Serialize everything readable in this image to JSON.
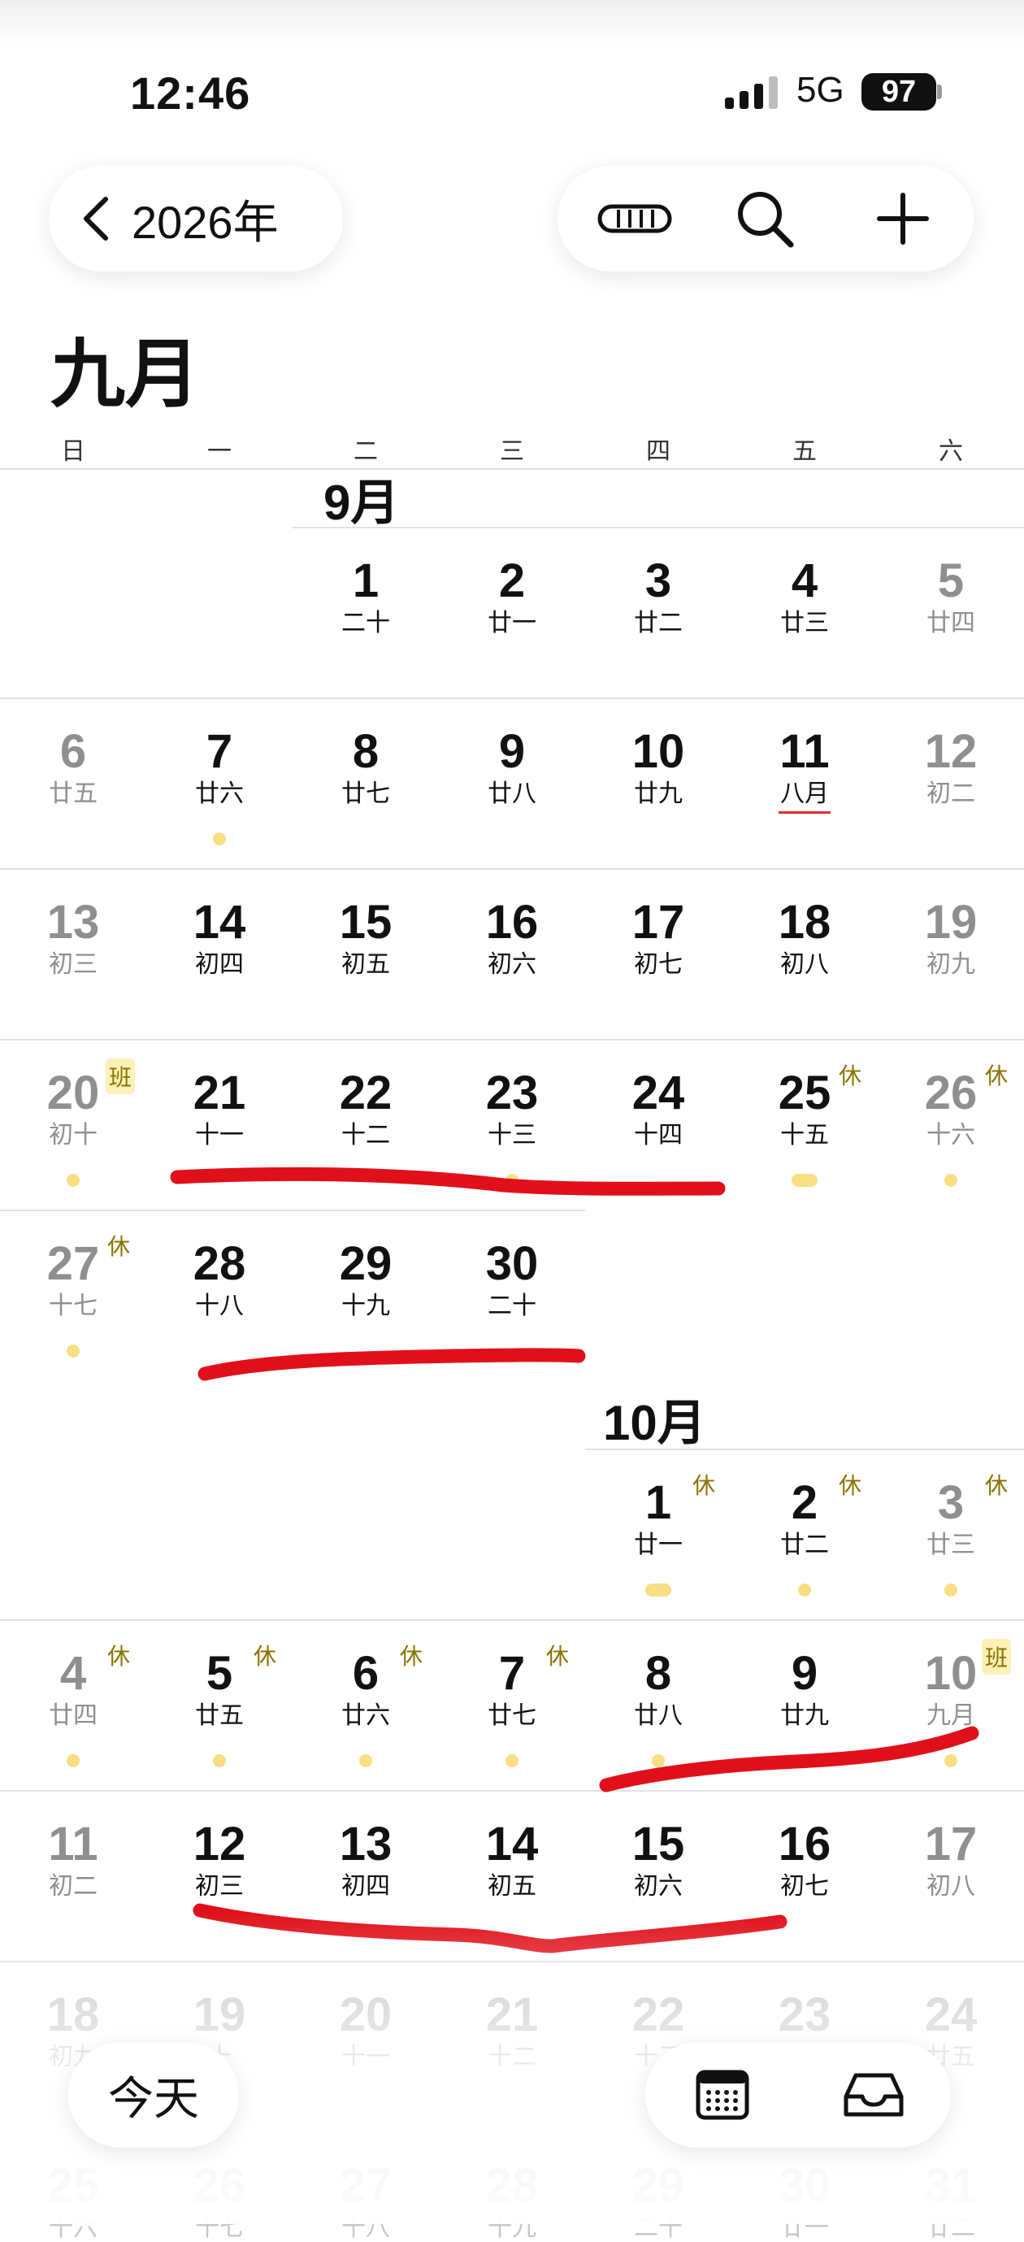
{
  "status": {
    "time": "12:46",
    "network": "5G",
    "battery": "97"
  },
  "toolbar": {
    "year": "2026年"
  },
  "month_title": "九月",
  "weekdays": [
    "日",
    "一",
    "二",
    "三",
    "四",
    "五",
    "六"
  ],
  "sep_label": "9月",
  "oct_label": "10月",
  "today_label": "今天",
  "tags": {
    "ban": "班",
    "xiu": "休"
  },
  "rows": [
    [
      "",
      "",
      "",
      "",
      "",
      "",
      ""
    ],
    [
      "",
      "",
      "",
      "",
      "",
      "",
      ""
    ]
  ],
  "sep_days": [
    {
      "d": "1",
      "l": "二十"
    },
    {
      "d": "2",
      "l": "廿一"
    },
    {
      "d": "3",
      "l": "廿二"
    },
    {
      "d": "4",
      "l": "廿三"
    },
    {
      "d": "5",
      "l": "廿四"
    },
    {
      "d": "6",
      "l": "廿五"
    },
    {
      "d": "7",
      "l": "廿六"
    },
    {
      "d": "8",
      "l": "廿七"
    },
    {
      "d": "9",
      "l": "廿八"
    },
    {
      "d": "10",
      "l": "廿九"
    },
    {
      "d": "11",
      "l": "八月"
    },
    {
      "d": "12",
      "l": "初二"
    },
    {
      "d": "13",
      "l": "初三"
    },
    {
      "d": "14",
      "l": "初四"
    },
    {
      "d": "15",
      "l": "初五"
    },
    {
      "d": "16",
      "l": "初六"
    },
    {
      "d": "17",
      "l": "初七"
    },
    {
      "d": "18",
      "l": "初八"
    },
    {
      "d": "19",
      "l": "初九"
    },
    {
      "d": "20",
      "l": "初十"
    },
    {
      "d": "21",
      "l": "十一"
    },
    {
      "d": "22",
      "l": "十二"
    },
    {
      "d": "23",
      "l": "十三"
    },
    {
      "d": "24",
      "l": "十四"
    },
    {
      "d": "25",
      "l": "十五"
    },
    {
      "d": "26",
      "l": "十六"
    },
    {
      "d": "27",
      "l": "十七"
    },
    {
      "d": "28",
      "l": "十八"
    },
    {
      "d": "29",
      "l": "十九"
    },
    {
      "d": "30",
      "l": "二十"
    }
  ],
  "oct_days": [
    {
      "d": "1",
      "l": "廿一"
    },
    {
      "d": "2",
      "l": "廿二"
    },
    {
      "d": "3",
      "l": "廿三"
    },
    {
      "d": "4",
      "l": "廿四"
    },
    {
      "d": "5",
      "l": "廿五"
    },
    {
      "d": "6",
      "l": "廿六"
    },
    {
      "d": "7",
      "l": "廿七"
    },
    {
      "d": "8",
      "l": "廿八"
    },
    {
      "d": "9",
      "l": "廿九"
    },
    {
      "d": "10",
      "l": "九月"
    },
    {
      "d": "11",
      "l": "初二"
    },
    {
      "d": "12",
      "l": "初三"
    },
    {
      "d": "13",
      "l": "初四"
    },
    {
      "d": "14",
      "l": "初五"
    },
    {
      "d": "15",
      "l": "初六"
    },
    {
      "d": "16",
      "l": "初七"
    },
    {
      "d": "17",
      "l": "初八"
    },
    {
      "d": "18",
      "l": "初九"
    },
    {
      "d": "19",
      "l": "十"
    },
    {
      "d": "20",
      "l": "十一"
    },
    {
      "d": "21",
      "l": "十二"
    },
    {
      "d": "22",
      "l": "十三"
    },
    {
      "d": "23",
      "l": ""
    },
    {
      "d": "24",
      "l": "廿五"
    },
    {
      "d": "25",
      "l": "十六"
    },
    {
      "d": "26",
      "l": "十七"
    },
    {
      "d": "27",
      "l": "十八"
    },
    {
      "d": "28",
      "l": "十九"
    },
    {
      "d": "29",
      "l": "二十"
    },
    {
      "d": "30",
      "l": "廿一"
    },
    {
      "d": "31",
      "l": "廿二"
    }
  ],
  "colors": {
    "accent_dot": "#f8de83",
    "holiday_tag": "#8a7400",
    "annotation": "#e0101a"
  },
  "icons": [
    "chevron-left-icon",
    "list-view-icon",
    "search-icon",
    "plus-icon",
    "calendar-icon",
    "inbox-icon",
    "signal-icon"
  ]
}
